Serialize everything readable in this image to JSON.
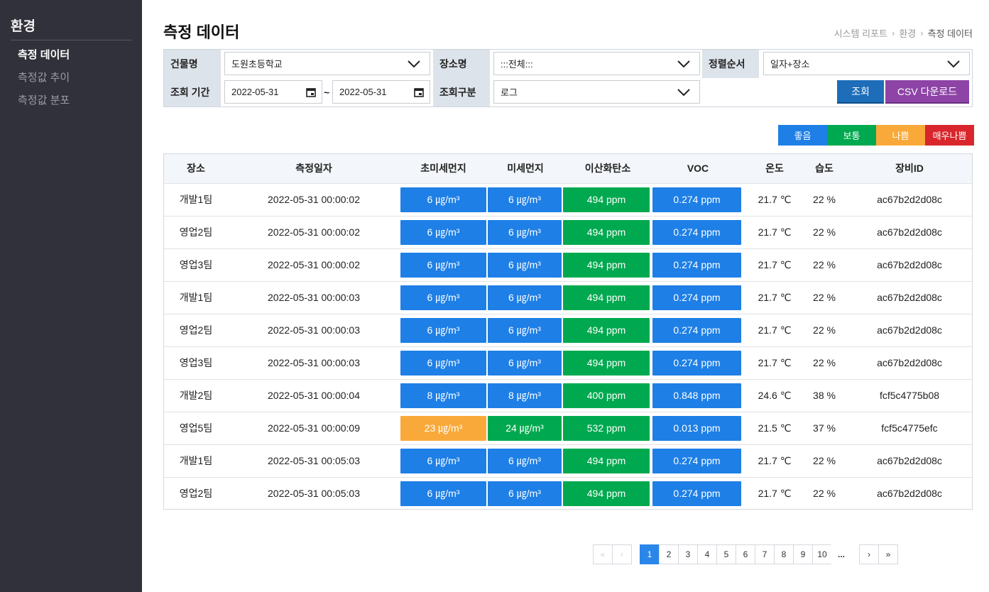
{
  "sidebar": {
    "title": "환경",
    "items": [
      {
        "label": "측정 데이터",
        "active": true
      },
      {
        "label": "측정값 추이",
        "active": false
      },
      {
        "label": "측정값 분포",
        "active": false
      }
    ]
  },
  "header": {
    "title": "측정 데이터",
    "breadcrumb": [
      "시스템 리포트",
      "환경",
      "측정 데이터"
    ]
  },
  "filters": {
    "building_label": "건물명",
    "building_value": "도원초등학교",
    "place_label": "장소명",
    "place_value": ":::전체:::",
    "sort_label": "정렬순서",
    "sort_value": "일자+장소",
    "period_label": "조회 기간",
    "date_from": "2022-05-31",
    "date_sep": "~",
    "date_to": "2022-05-31",
    "type_label": "조회구분",
    "type_value": "로그",
    "search_button": "조회",
    "csv_button": "CSV 다운로드"
  },
  "legend": [
    {
      "label": "좋음",
      "color": "#1e7fe6"
    },
    {
      "label": "보통",
      "color": "#00a94f"
    },
    {
      "label": "나쁨",
      "color": "#f9a93a"
    },
    {
      "label": "매우나쁨",
      "color": "#d9262c"
    }
  ],
  "table": {
    "columns": [
      "장소",
      "측정일자",
      "초미세먼지",
      "미세먼지",
      "이산화탄소",
      "VOC",
      "온도",
      "습도",
      "장비ID"
    ],
    "rows": [
      {
        "place": "개발1팀",
        "date": "2022-05-31 00:00:02",
        "pm25": "6 ㎍/m³",
        "pm25_level": "good",
        "pm10": "6 ㎍/m³",
        "pm10_level": "good",
        "co2": "494 ppm",
        "co2_level": "normal",
        "voc": "0.274 ppm",
        "voc_level": "good",
        "temp": "21.7 ℃",
        "hum": "22 %",
        "device": "ac67b2d2d08c"
      },
      {
        "place": "영업2팀",
        "date": "2022-05-31 00:00:02",
        "pm25": "6 ㎍/m³",
        "pm25_level": "good",
        "pm10": "6 ㎍/m³",
        "pm10_level": "good",
        "co2": "494 ppm",
        "co2_level": "normal",
        "voc": "0.274 ppm",
        "voc_level": "good",
        "temp": "21.7 ℃",
        "hum": "22 %",
        "device": "ac67b2d2d08c"
      },
      {
        "place": "영업3팀",
        "date": "2022-05-31 00:00:02",
        "pm25": "6 ㎍/m³",
        "pm25_level": "good",
        "pm10": "6 ㎍/m³",
        "pm10_level": "good",
        "co2": "494 ppm",
        "co2_level": "normal",
        "voc": "0.274 ppm",
        "voc_level": "good",
        "temp": "21.7 ℃",
        "hum": "22 %",
        "device": "ac67b2d2d08c"
      },
      {
        "place": "개발1팀",
        "date": "2022-05-31 00:00:03",
        "pm25": "6 ㎍/m³",
        "pm25_level": "good",
        "pm10": "6 ㎍/m³",
        "pm10_level": "good",
        "co2": "494 ppm",
        "co2_level": "normal",
        "voc": "0.274 ppm",
        "voc_level": "good",
        "temp": "21.7 ℃",
        "hum": "22 %",
        "device": "ac67b2d2d08c"
      },
      {
        "place": "영업2팀",
        "date": "2022-05-31 00:00:03",
        "pm25": "6 ㎍/m³",
        "pm25_level": "good",
        "pm10": "6 ㎍/m³",
        "pm10_level": "good",
        "co2": "494 ppm",
        "co2_level": "normal",
        "voc": "0.274 ppm",
        "voc_level": "good",
        "temp": "21.7 ℃",
        "hum": "22 %",
        "device": "ac67b2d2d08c"
      },
      {
        "place": "영업3팀",
        "date": "2022-05-31 00:00:03",
        "pm25": "6 ㎍/m³",
        "pm25_level": "good",
        "pm10": "6 ㎍/m³",
        "pm10_level": "good",
        "co2": "494 ppm",
        "co2_level": "normal",
        "voc": "0.274 ppm",
        "voc_level": "good",
        "temp": "21.7 ℃",
        "hum": "22 %",
        "device": "ac67b2d2d08c"
      },
      {
        "place": "개발2팀",
        "date": "2022-05-31 00:00:04",
        "pm25": "8 ㎍/m³",
        "pm25_level": "good",
        "pm10": "8 ㎍/m³",
        "pm10_level": "good",
        "co2": "400 ppm",
        "co2_level": "normal",
        "voc": "0.848 ppm",
        "voc_level": "good",
        "temp": "24.6 ℃",
        "hum": "38 %",
        "device": "fcf5c4775b08"
      },
      {
        "place": "영업5팀",
        "date": "2022-05-31 00:00:09",
        "pm25": "23 ㎍/m³",
        "pm25_level": "bad",
        "pm10": "24 ㎍/m³",
        "pm10_level": "normal",
        "co2": "532 ppm",
        "co2_level": "normal",
        "voc": "0.013 ppm",
        "voc_level": "good",
        "temp": "21.5 ℃",
        "hum": "37 %",
        "device": "fcf5c4775efc"
      },
      {
        "place": "개발1팀",
        "date": "2022-05-31 00:05:03",
        "pm25": "6 ㎍/m³",
        "pm25_level": "good",
        "pm10": "6 ㎍/m³",
        "pm10_level": "good",
        "co2": "494 ppm",
        "co2_level": "normal",
        "voc": "0.274 ppm",
        "voc_level": "good",
        "temp": "21.7 ℃",
        "hum": "22 %",
        "device": "ac67b2d2d08c"
      },
      {
        "place": "영업2팀",
        "date": "2022-05-31 00:05:03",
        "pm25": "6 ㎍/m³",
        "pm25_level": "good",
        "pm10": "6 ㎍/m³",
        "pm10_level": "good",
        "co2": "494 ppm",
        "co2_level": "normal",
        "voc": "0.274 ppm",
        "voc_level": "good",
        "temp": "21.7 ℃",
        "hum": "22 %",
        "device": "ac67b2d2d08c"
      }
    ]
  },
  "level_colors": {
    "good": "#1e7fe6",
    "normal": "#00a94f",
    "bad": "#f9a93a",
    "very_bad": "#d9262c"
  },
  "pagination": {
    "first": "«",
    "prev": "‹",
    "pages": [
      "1",
      "2",
      "3",
      "4",
      "5",
      "6",
      "7",
      "8",
      "9",
      "10"
    ],
    "current": "1",
    "ellipsis": "...",
    "next": "›",
    "last": "»"
  }
}
